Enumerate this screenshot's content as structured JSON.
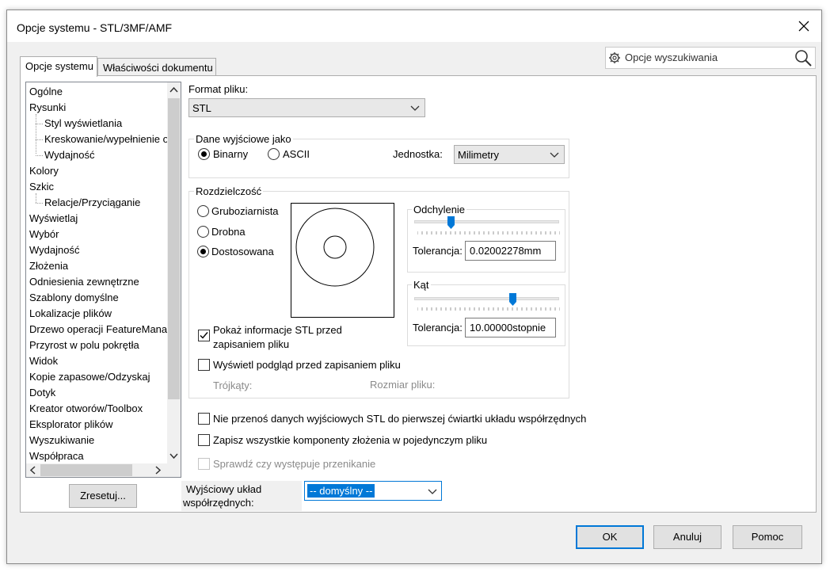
{
  "window": {
    "title": "Opcje systemu - STL/3MF/AMF"
  },
  "tabs": [
    {
      "label": "Opcje systemu"
    },
    {
      "label": "Właściwości dokumentu"
    }
  ],
  "search": {
    "placeholder": "Opcje wyszukiwania"
  },
  "tree": {
    "items": [
      {
        "label": "Ogólne"
      },
      {
        "label": "Rysunki"
      },
      {
        "label": "Styl wyświetlania"
      },
      {
        "label": "Kreskowanie/wypełnienie o"
      },
      {
        "label": "Wydajność"
      },
      {
        "label": "Kolory"
      },
      {
        "label": "Szkic"
      },
      {
        "label": "Relacje/Przyciąganie"
      },
      {
        "label": "Wyświetlaj"
      },
      {
        "label": "Wybór"
      },
      {
        "label": "Wydajność"
      },
      {
        "label": "Złożenia"
      },
      {
        "label": "Odniesienia zewnętrzne"
      },
      {
        "label": "Szablony domyślne"
      },
      {
        "label": "Lokalizacje plików"
      },
      {
        "label": "Drzewo operacji FeatureMana"
      },
      {
        "label": "Przyrost w polu pokrętła"
      },
      {
        "label": "Widok"
      },
      {
        "label": "Kopie zapasowe/Odzyskaj"
      },
      {
        "label": "Dotyk"
      },
      {
        "label": "Kreator otworów/Toolbox"
      },
      {
        "label": "Eksplorator plików"
      },
      {
        "label": "Wyszukiwanie"
      },
      {
        "label": "Współpraca"
      }
    ]
  },
  "reset_button": "Zresetuj...",
  "format": {
    "label": "Format pliku:",
    "value": "STL"
  },
  "output": {
    "legend": "Dane wyjściowe jako",
    "binary": "Binarny",
    "ascii": "ASCII",
    "selected": "Binarny",
    "unit_label": "Jednostka:",
    "unit_value": "Milimetry"
  },
  "resolution": {
    "legend": "Rozdzielczość",
    "coarse": "Gruboziarnista",
    "fine": "Drobna",
    "custom": "Dostosowana",
    "selected": "Dostosowana",
    "deviation": {
      "legend": "Odchylenie",
      "tolerance_label": "Tolerancja:",
      "tolerance_value": "0.02002278mm",
      "slider_level": 0.25
    },
    "angle": {
      "legend": "Kąt",
      "tolerance_label": "Tolerancja:",
      "tolerance_value": "10.00000stopnie",
      "slider_level": 0.68
    },
    "show_info": "Pokaż informacje STL przed zapisaniem pliku",
    "show_info_line1": "Pokaż informacje STL przed",
    "show_info_line2": "zapisaniem pliku",
    "show_info_checked": true,
    "preview": "Wyświetl podgląd przed zapisaniem pliku",
    "preview_checked": false,
    "triangles_label": "Trójkąty:",
    "filesize_label": "Rozmiar pliku:"
  },
  "options": {
    "no_first_quadrant": "Nie przenoś danych wyjściowych STL do pierwszej ćwiartki układu współrzędnych",
    "save_all_components": "Zapisz wszystkie komponenty złożenia w pojedynczym pliku",
    "check_interference": "Sprawdź czy występuje przenikanie"
  },
  "coord": {
    "label_line1": "Wyjściowy układ",
    "label_line2": "współrzędnych:",
    "value": "-- domyślny --"
  },
  "buttons": {
    "ok": "OK",
    "cancel": "Anuluj",
    "help": "Pomoc"
  },
  "colors": {
    "accent": "#0078d7",
    "selection": "#0078d7"
  }
}
